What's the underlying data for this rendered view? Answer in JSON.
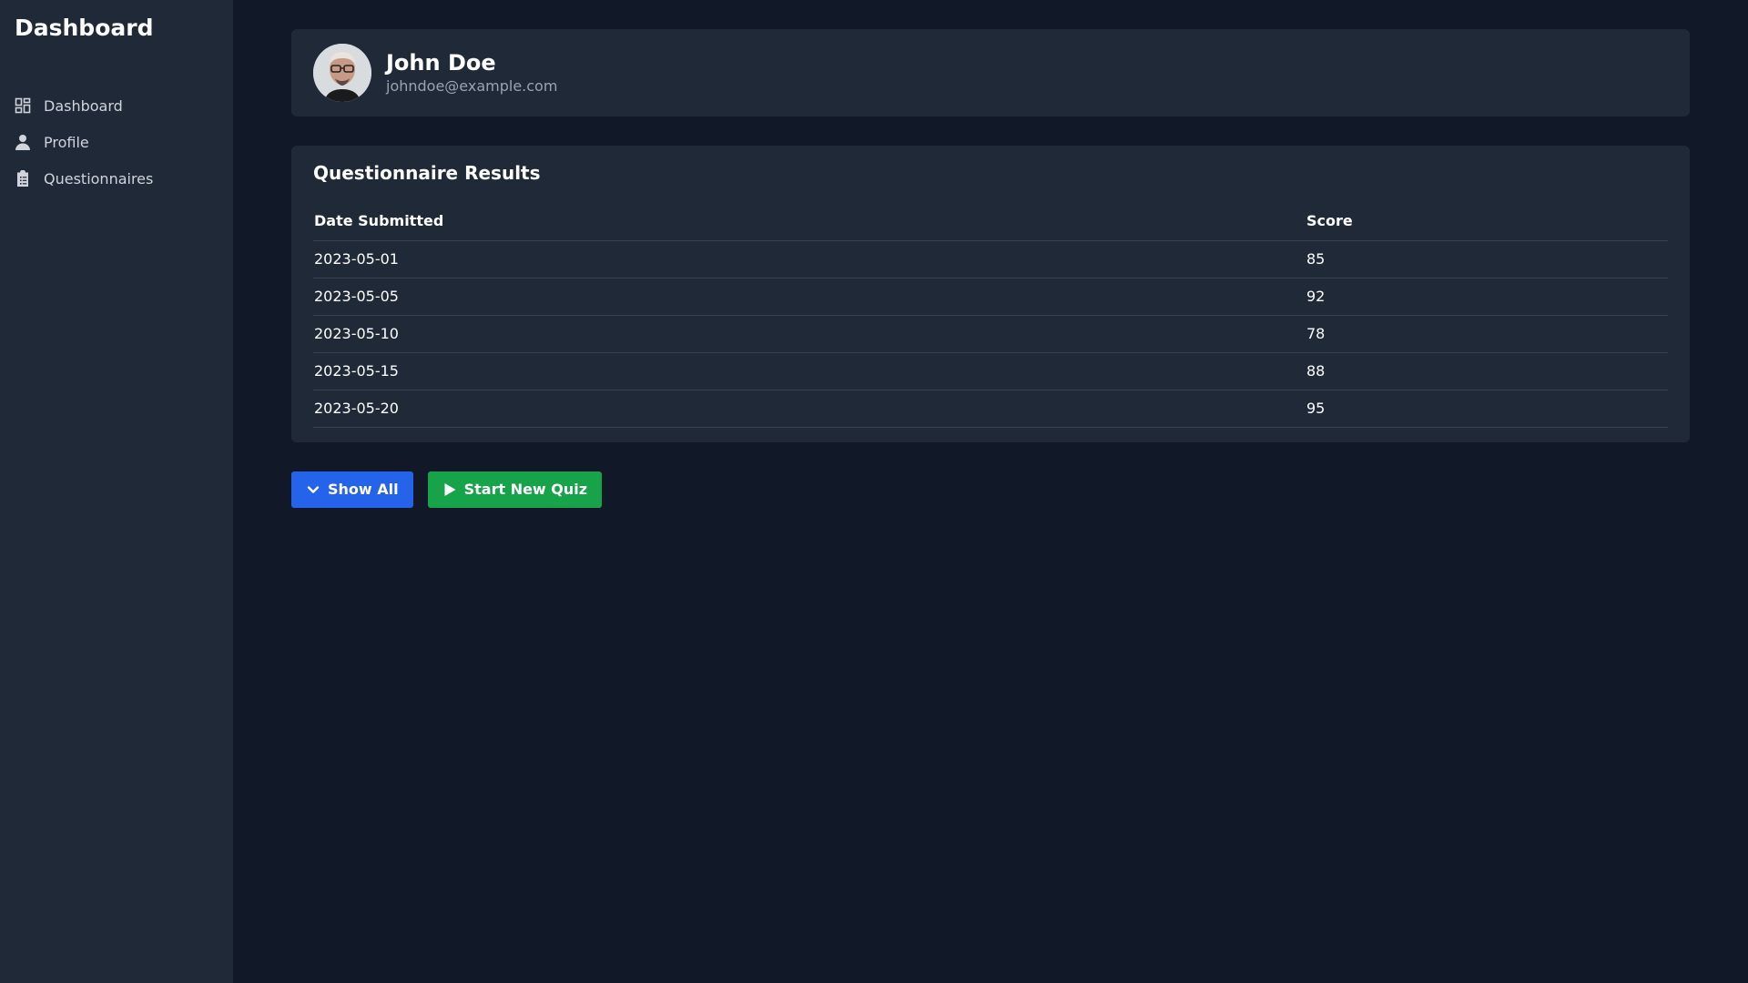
{
  "sidebar": {
    "title": "Dashboard",
    "items": [
      {
        "label": "Dashboard",
        "icon": "grid-icon"
      },
      {
        "label": "Profile",
        "icon": "user-icon"
      },
      {
        "label": "Questionnaires",
        "icon": "clipboard-icon"
      }
    ]
  },
  "profile": {
    "name": "John Doe",
    "email": "johndoe@example.com"
  },
  "results": {
    "title": "Questionnaire Results",
    "columns": [
      "Date Submitted",
      "Score"
    ],
    "rows": [
      {
        "date": "2023-05-01",
        "score": "85"
      },
      {
        "date": "2023-05-05",
        "score": "92"
      },
      {
        "date": "2023-05-10",
        "score": "78"
      },
      {
        "date": "2023-05-15",
        "score": "88"
      },
      {
        "date": "2023-05-20",
        "score": "95"
      }
    ]
  },
  "actions": {
    "show_all_label": "Show All",
    "start_quiz_label": "Start New Quiz"
  },
  "colors": {
    "background": "#111827",
    "panel": "#1f2937",
    "primary": "#2563eb",
    "success": "#16a34a"
  }
}
